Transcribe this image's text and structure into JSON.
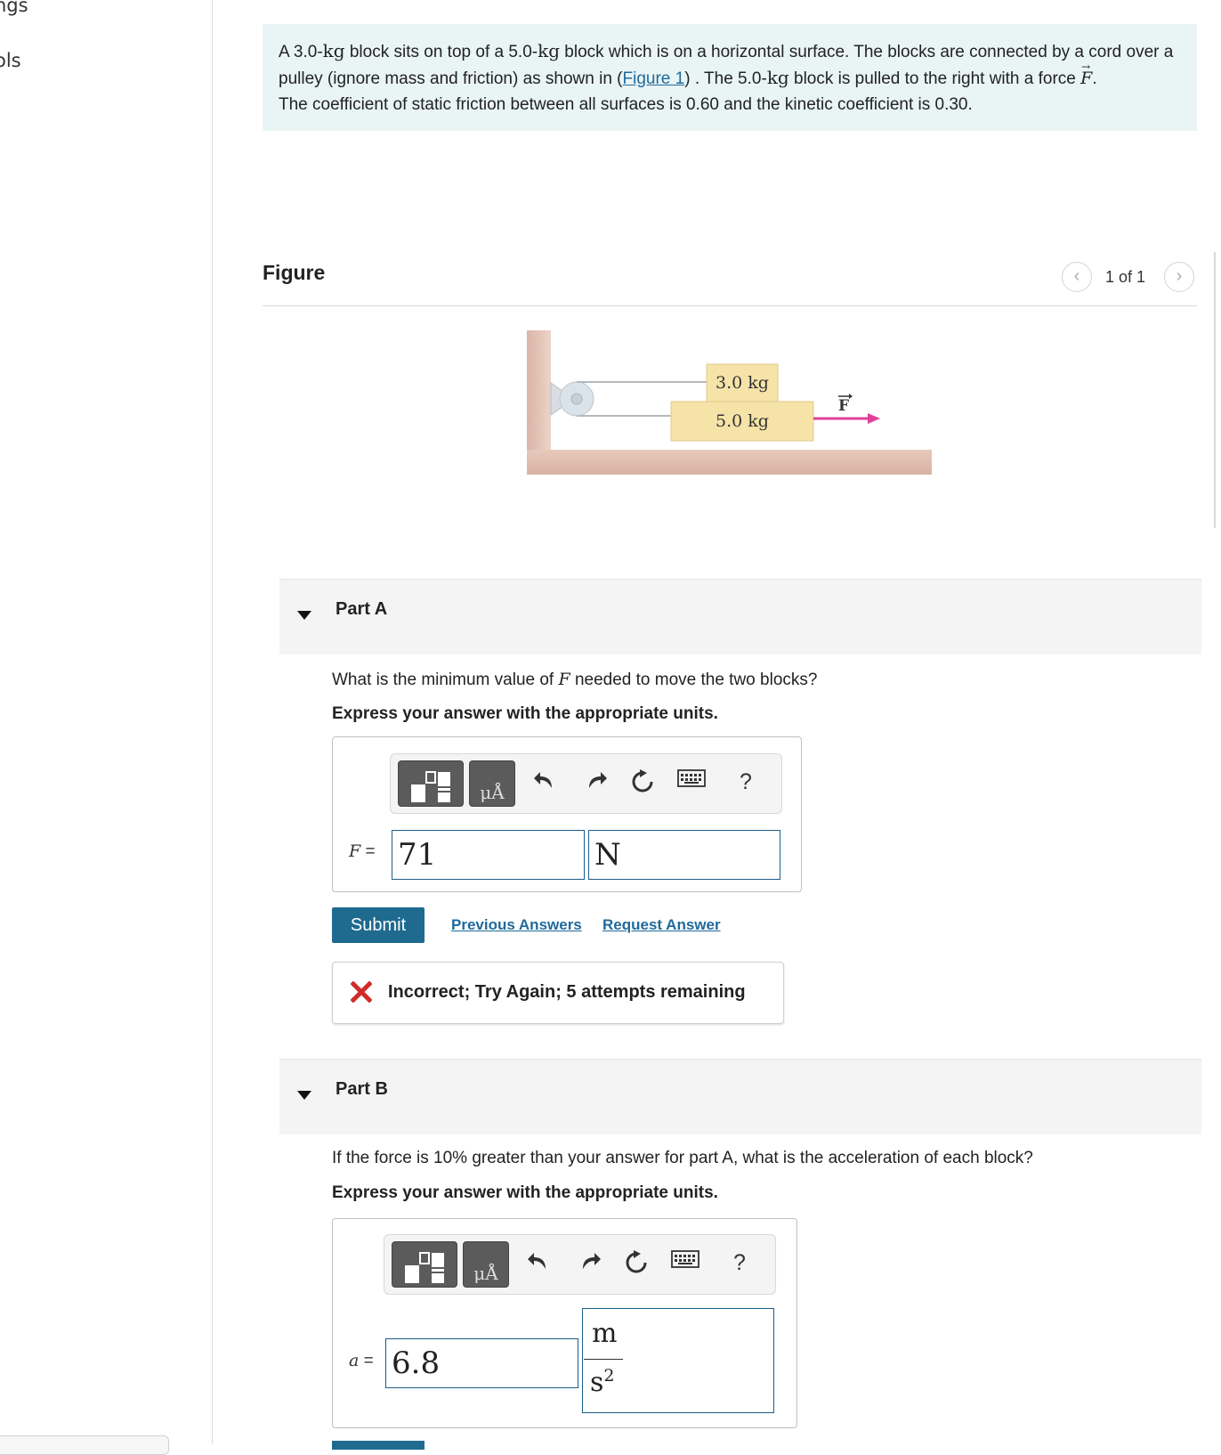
{
  "sidebar": {
    "items": [
      "ngs",
      "ols"
    ]
  },
  "intro": {
    "p1_a": "A 3.0-",
    "p1_kg1": "kg",
    "p1_b": " block sits on top of a 5.0-",
    "p1_kg2": "kg",
    "p1_c": " block which is on a horizontal surface. The blocks are connected by a cord over a pulley (ignore mass and friction) as shown in (",
    "figure_link": "Figure 1",
    "p1_d": ") . The 5.0-",
    "p1_kg3": "kg",
    "p1_e": " block is pulled to the right with a force ",
    "force_symbol": "F",
    "p1_f": ".",
    "p2": "The coefficient of static friction between all surfaces is 0.60 and the kinetic coefficient is 0.30."
  },
  "figure": {
    "title": "Figure",
    "counter": "1 of 1",
    "top_block_label": "3.0 kg",
    "bottom_block_label": "5.0 kg",
    "force_label": "F"
  },
  "partA": {
    "title": "Part A",
    "question_a": "What is the minimum value of ",
    "question_var": "F",
    "question_b": " needed to move the two blocks?",
    "instruction": "Express your answer with the appropriate units.",
    "var_name": "F",
    "equals": " =",
    "value": "71",
    "unit": "N",
    "submit_label": "Submit",
    "previous_answers": "Previous Answers",
    "request_answer": "Request Answer",
    "feedback": "Incorrect; Try Again; 5 attempts remaining"
  },
  "partB": {
    "title": "Part B",
    "question": "If the force is 10% greater than your answer for part A, what is the acceleration of each block?",
    "instruction": "Express your answer with the appropriate units.",
    "var_name": "a",
    "equals": " =",
    "value": "6.8",
    "unit_num": "m",
    "unit_den": "s",
    "unit_den_exp": "2"
  },
  "toolbar": {
    "units_glyph": "μÅ",
    "help": "?"
  },
  "colors": {
    "intro_bg": "#e9f4f5",
    "link": "#1f6a9c",
    "submit_bg": "#1f6a8f",
    "input_border": "#1b5f8a",
    "error_red": "#d12a2a",
    "force_arrow": "#e0409a",
    "block_fill": "#f6e3a8"
  }
}
